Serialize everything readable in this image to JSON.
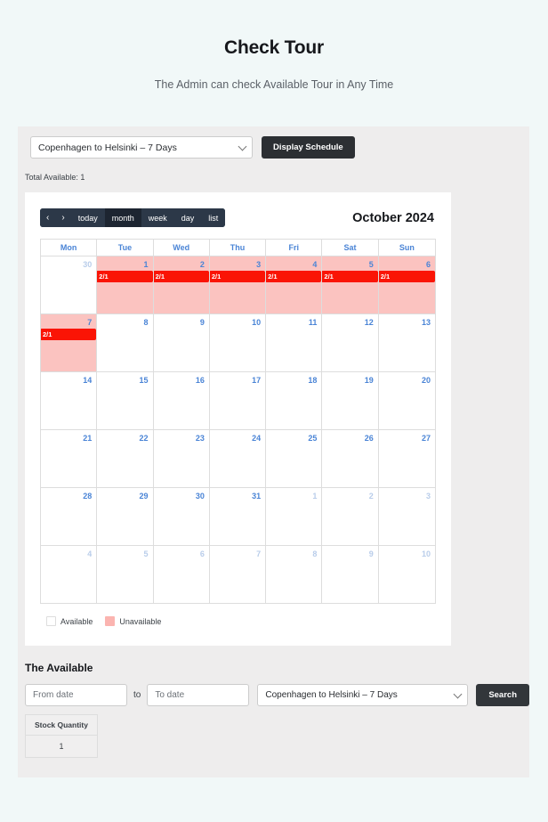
{
  "header": {
    "title": "Check Tour",
    "subtitle": "The Admin can check Available Tour in Any Time"
  },
  "controls": {
    "tour_select_value": "Copenhagen to Helsinki – 7 Days",
    "display_button": "Display Schedule",
    "total_available": "Total Available: 1"
  },
  "calendar": {
    "toolbar": {
      "prev": "‹",
      "next": "›",
      "today": "today",
      "month": "month",
      "week": "week",
      "day": "day",
      "list": "list",
      "active": "month"
    },
    "title": "October 2024",
    "weekdays": [
      "Mon",
      "Tue",
      "Wed",
      "Thu",
      "Fri",
      "Sat",
      "Sun"
    ],
    "event_label": "2/1",
    "colors": {
      "unavailable_cell": "#FBC3C0",
      "event_bar": "#FA1405",
      "daynum": "#4A84D6",
      "daynum_other": "#B9CDEA",
      "toolbar": "#2C3848",
      "toolbar_active": "#1D2531"
    },
    "weeks": [
      [
        {
          "day": "30",
          "other": true,
          "unavailable": false,
          "event": false
        },
        {
          "day": "1",
          "other": false,
          "unavailable": true,
          "event": true
        },
        {
          "day": "2",
          "other": false,
          "unavailable": true,
          "event": true
        },
        {
          "day": "3",
          "other": false,
          "unavailable": true,
          "event": true
        },
        {
          "day": "4",
          "other": false,
          "unavailable": true,
          "event": true
        },
        {
          "day": "5",
          "other": false,
          "unavailable": true,
          "event": true
        },
        {
          "day": "6",
          "other": false,
          "unavailable": true,
          "event": true
        }
      ],
      [
        {
          "day": "7",
          "other": false,
          "unavailable": true,
          "event": true
        },
        {
          "day": "8",
          "other": false,
          "unavailable": false,
          "event": false
        },
        {
          "day": "9",
          "other": false,
          "unavailable": false,
          "event": false
        },
        {
          "day": "10",
          "other": false,
          "unavailable": false,
          "event": false
        },
        {
          "day": "11",
          "other": false,
          "unavailable": false,
          "event": false
        },
        {
          "day": "12",
          "other": false,
          "unavailable": false,
          "event": false
        },
        {
          "day": "13",
          "other": false,
          "unavailable": false,
          "event": false
        }
      ],
      [
        {
          "day": "14",
          "other": false,
          "unavailable": false,
          "event": false
        },
        {
          "day": "15",
          "other": false,
          "unavailable": false,
          "event": false
        },
        {
          "day": "16",
          "other": false,
          "unavailable": false,
          "event": false
        },
        {
          "day": "17",
          "other": false,
          "unavailable": false,
          "event": false
        },
        {
          "day": "18",
          "other": false,
          "unavailable": false,
          "event": false
        },
        {
          "day": "19",
          "other": false,
          "unavailable": false,
          "event": false
        },
        {
          "day": "20",
          "other": false,
          "unavailable": false,
          "event": false
        }
      ],
      [
        {
          "day": "21",
          "other": false,
          "unavailable": false,
          "event": false
        },
        {
          "day": "22",
          "other": false,
          "unavailable": false,
          "event": false
        },
        {
          "day": "23",
          "other": false,
          "unavailable": false,
          "event": false
        },
        {
          "day": "24",
          "other": false,
          "unavailable": false,
          "event": false
        },
        {
          "day": "25",
          "other": false,
          "unavailable": false,
          "event": false
        },
        {
          "day": "26",
          "other": false,
          "unavailable": false,
          "event": false
        },
        {
          "day": "27",
          "other": false,
          "unavailable": false,
          "event": false
        }
      ],
      [
        {
          "day": "28",
          "other": false,
          "unavailable": false,
          "event": false
        },
        {
          "day": "29",
          "other": false,
          "unavailable": false,
          "event": false
        },
        {
          "day": "30",
          "other": false,
          "unavailable": false,
          "event": false
        },
        {
          "day": "31",
          "other": false,
          "unavailable": false,
          "event": false
        },
        {
          "day": "1",
          "other": true,
          "unavailable": false,
          "event": false
        },
        {
          "day": "2",
          "other": true,
          "unavailable": false,
          "event": false
        },
        {
          "day": "3",
          "other": true,
          "unavailable": false,
          "event": false
        }
      ],
      [
        {
          "day": "4",
          "other": true,
          "unavailable": false,
          "event": false
        },
        {
          "day": "5",
          "other": true,
          "unavailable": false,
          "event": false
        },
        {
          "day": "6",
          "other": true,
          "unavailable": false,
          "event": false
        },
        {
          "day": "7",
          "other": true,
          "unavailable": false,
          "event": false
        },
        {
          "day": "8",
          "other": true,
          "unavailable": false,
          "event": false
        },
        {
          "day": "9",
          "other": true,
          "unavailable": false,
          "event": false
        },
        {
          "day": "10",
          "other": true,
          "unavailable": false,
          "event": false
        }
      ]
    ],
    "legend": [
      {
        "label": "Available",
        "type": "available"
      },
      {
        "label": "Unavailable",
        "type": "unavailable"
      }
    ]
  },
  "available_section": {
    "title": "The Available",
    "from_placeholder": "From date",
    "from_value": "",
    "to_label": "to",
    "to_placeholder": "To date",
    "to_value": "",
    "tour_select_value": "Copenhagen to Helsinki – 7 Days",
    "search_button": "Search",
    "table": {
      "headers": [
        "Stock Quantity"
      ],
      "rows": [
        [
          "1"
        ]
      ]
    }
  }
}
